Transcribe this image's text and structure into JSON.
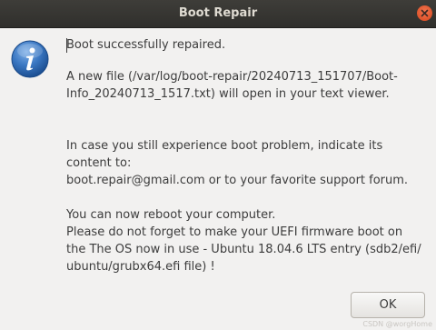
{
  "window": {
    "title": "Boot Repair"
  },
  "icons": {
    "info": "info-icon",
    "close": "close-icon"
  },
  "message": {
    "heading": "Boot successfully repaired.",
    "file_notice": "A new file (/var/log/boot-repair/20240713_151707/Boot-\nInfo_20240713_1517.txt) will open in your text viewer.",
    "problem_notice": "In case you still experience boot problem, indicate its\ncontent to:\nboot.repair@gmail.com or to your favorite support forum.",
    "reboot_notice": "You can now reboot your computer.\nPlease do not forget to make your UEFI firmware boot on\nthe The OS now in use - Ubuntu 18.04.6 LTS entry (sdb2/efi/\nubuntu/grubx64.efi file) !"
  },
  "buttons": {
    "ok_label": "OK"
  },
  "watermark": "CSDN @worgHome",
  "colors": {
    "titlebar": "#353431",
    "close_button": "#e95420",
    "info_icon": "#3a77c2",
    "background": "#f2f1f0"
  }
}
